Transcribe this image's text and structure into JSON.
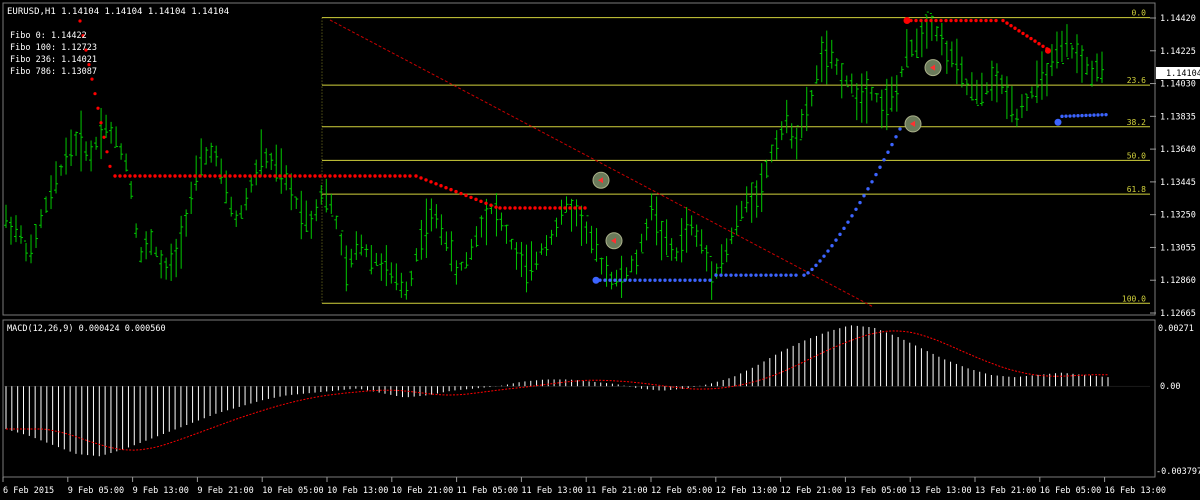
{
  "header": {
    "symbol_line": "EURUSD,H1  1.14104 1.14104 1.14104 1.14104",
    "fibo_info": [
      "Fibo 0: 1.14422",
      "Fibo 100: 1.12723",
      "Fibo 236: 1.14021",
      "Fibo 786: 1.13087"
    ]
  },
  "macd_panel": {
    "title": "MACD(12,26,9) 0.000424 0.000560",
    "tick_labels": [
      "0.00271",
      "0.00",
      "-0.003797"
    ]
  },
  "price_scale": {
    "tick_labels": [
      "1.14420",
      "1.14225",
      "1.14030",
      "1.13835",
      "1.13640",
      "1.13445",
      "1.13250",
      "1.13055",
      "1.12860",
      "1.12665"
    ],
    "current_price_label": "1.14104"
  },
  "time_axis": {
    "labels": [
      "6 Feb 2015",
      "9 Feb 05:00",
      "9 Feb 13:00",
      "9 Feb 21:00",
      "10 Feb 05:00",
      "10 Feb 13:00",
      "10 Feb 21:00",
      "11 Feb 05:00",
      "11 Feb 13:00",
      "11 Feb 21:00",
      "12 Feb 05:00",
      "12 Feb 13:00",
      "12 Feb 21:00",
      "13 Feb 05:00",
      "13 Feb 13:00",
      "13 Feb 21:00",
      "16 Feb 05:00",
      "16 Feb 13:00"
    ]
  },
  "colors": {
    "background": "#000000",
    "bars": "#00c800",
    "grid": "#3a3a3a",
    "axis_text": "#ffffff",
    "fib_line": "#d2d23c",
    "fib_label": "#d2d23c",
    "sar_high": "#ff0000",
    "sar_low": "#3c64ff",
    "macd_histogram": "#ffffff",
    "macd_signal": "#ff0000",
    "trendline": "#c80000"
  },
  "chart_data": [
    {
      "type": "candlestick-bars",
      "symbol": "EURUSD",
      "timeframe": "H1",
      "ylim": [
        1.12665,
        1.1442
      ],
      "fibonacci_levels": [
        {
          "label": "0.0",
          "price": 1.14422
        },
        {
          "label": "23.6",
          "price": 1.14021
        },
        {
          "label": "38.2",
          "price": 1.13773
        },
        {
          "label": "50.0",
          "price": 1.13573
        },
        {
          "label": "61.8",
          "price": 1.13372
        },
        {
          "label": "100.0",
          "price": 1.12723
        }
      ],
      "close_path": [
        1.1322,
        1.1315,
        1.13,
        1.1325,
        1.1342,
        1.1362,
        1.137,
        1.136,
        1.138,
        1.137,
        1.1355,
        1.13,
        1.131,
        1.129,
        1.13,
        1.133,
        1.1355,
        1.1365,
        1.134,
        1.132,
        1.134,
        1.136,
        1.1355,
        1.1345,
        1.133,
        1.132,
        1.134,
        1.1325,
        1.129,
        1.131,
        1.13,
        1.1295,
        1.1285,
        1.128,
        1.131,
        1.1325,
        1.1315,
        1.129,
        1.13,
        1.132,
        1.133,
        1.1315,
        1.13,
        1.129,
        1.1305,
        1.1315,
        1.133,
        1.1325,
        1.131,
        1.1295,
        1.1285,
        1.129,
        1.13,
        1.133,
        1.131,
        1.13,
        1.132,
        1.131,
        1.129,
        1.13,
        1.132,
        1.1335,
        1.134,
        1.1365,
        1.138,
        1.137,
        1.139,
        1.142,
        1.1415,
        1.1405,
        1.1395,
        1.14,
        1.139,
        1.1395,
        1.142,
        1.143,
        1.144,
        1.1425,
        1.1415,
        1.14,
        1.1395,
        1.1405,
        1.14,
        1.1385,
        1.1395,
        1.1405,
        1.1415,
        1.1425,
        1.142,
        1.141,
        1.141
      ],
      "sar_high": {
        "start_price": 1.14422,
        "plateau_price": 1.1348,
        "step_price": 1.1329
      },
      "sar_low": {
        "start_price": 1.1286,
        "step_price": 1.1289,
        "end_price": 1.1376
      },
      "trendline": {
        "from_price": 1.1442,
        "to_price": 1.12723
      }
    },
    {
      "type": "macd",
      "params": [
        12,
        26,
        9
      ],
      "main": 0.000424,
      "signal": 0.00056,
      "ylim": [
        -0.003797,
        0.00271
      ],
      "histogram_profile": [
        -0.0019,
        -0.0022,
        -0.0026,
        -0.003,
        -0.0031,
        -0.0028,
        -0.0024,
        -0.002,
        -0.0016,
        -0.0012,
        -0.0009,
        -0.0006,
        -0.0004,
        -0.0003,
        -0.0002,
        -0.0001,
        -0.0003,
        -0.0005,
        -0.0004,
        -0.0002,
        -0.0001,
        0.0,
        0.0002,
        0.0003,
        0.0003,
        0.0002,
        0.0001,
        -0.0001,
        -0.0002,
        -0.0001,
        0.0001,
        0.0004,
        0.0009,
        0.0015,
        0.002,
        0.0024,
        0.0027,
        0.0026,
        0.0022,
        0.0017,
        0.0012,
        0.0008,
        0.0005,
        0.0004,
        0.0005,
        0.0006,
        0.0005,
        0.0004
      ]
    }
  ]
}
